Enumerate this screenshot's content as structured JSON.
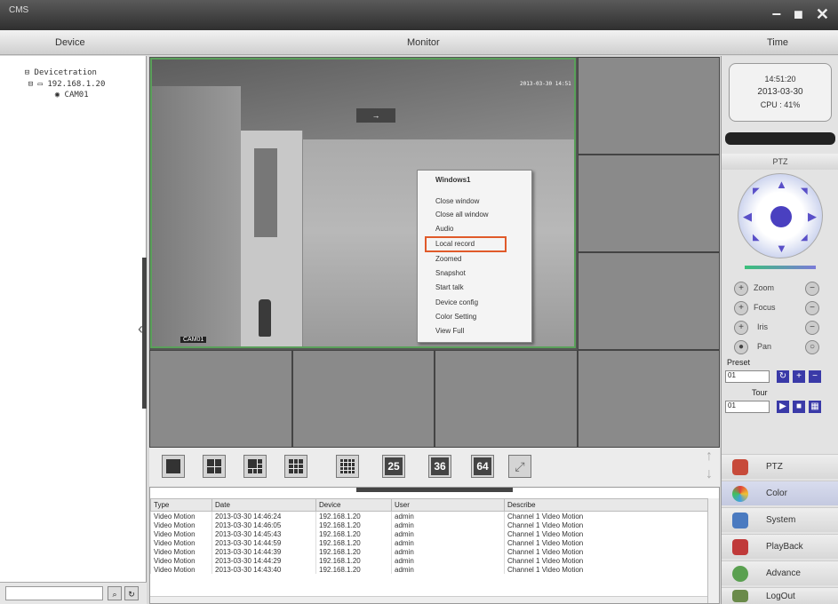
{
  "window": {
    "title": "CMS"
  },
  "header": {
    "device": "Device",
    "monitor": "Monitor",
    "time": "Time"
  },
  "device_tree": {
    "root": "Devicetration",
    "ip": "192.168.1.20",
    "camera": "CAM01",
    "search_placeholder": ""
  },
  "video": {
    "timestamp": "2013-03-30 14:51",
    "cam_label": "CAM01"
  },
  "context_menu": {
    "items": [
      "Windows1",
      "Close window",
      "Close all window",
      "Audio",
      "Local record",
      "Zoomed",
      "Snapshot",
      "Start talk",
      "Device config",
      "Color Setting",
      "View Full"
    ],
    "highlighted_index": 4
  },
  "layout_buttons": {
    "labels": [
      "25",
      "36",
      "64"
    ]
  },
  "log": {
    "columns": [
      "Type",
      "Date",
      "Device",
      "User",
      "Describe"
    ],
    "rows": [
      [
        "Video Motion",
        "2013-03-30 14:46:24",
        "192.168.1.20",
        "admin",
        "Channel 1 Video Motion"
      ],
      [
        "Video Motion",
        "2013-03-30 14:46:05",
        "192.168.1.20",
        "admin",
        "Channel 1 Video Motion"
      ],
      [
        "Video Motion",
        "2013-03-30 14:45:43",
        "192.168.1.20",
        "admin",
        "Channel 1 Video Motion"
      ],
      [
        "Video Motion",
        "2013-03-30 14:44:59",
        "192.168.1.20",
        "admin",
        "Channel 1 Video Motion"
      ],
      [
        "Video Motion",
        "2013-03-30 14:44:39",
        "192.168.1.20",
        "admin",
        "Channel 1 Video Motion"
      ],
      [
        "Video Motion",
        "2013-03-30 14:44:29",
        "192.168.1.20",
        "admin",
        "Channel 1 Video Motion"
      ],
      [
        "Video Motion",
        "2013-03-30 14:43:40",
        "192.168.1.20",
        "admin",
        "Channel 1 Video Motion"
      ]
    ]
  },
  "clock": {
    "time": "14:51:20",
    "date": "2013-03-30",
    "cpu": "CPU : 41%"
  },
  "ptz": {
    "title": "PTZ",
    "zoom": "Zoom",
    "focus": "Focus",
    "iris": "Iris",
    "pan": "Pan",
    "preset_label": "Preset",
    "preset_value": "01",
    "tour_label": "Tour",
    "tour_value": "01"
  },
  "nav": {
    "items": [
      "PTZ",
      "Color",
      "System",
      "PlayBack",
      "Advance",
      "LogOut"
    ]
  },
  "colors": {
    "accent": "#5a50c8",
    "highlight": "#e05a2a",
    "active_border": "#5aa05a"
  }
}
